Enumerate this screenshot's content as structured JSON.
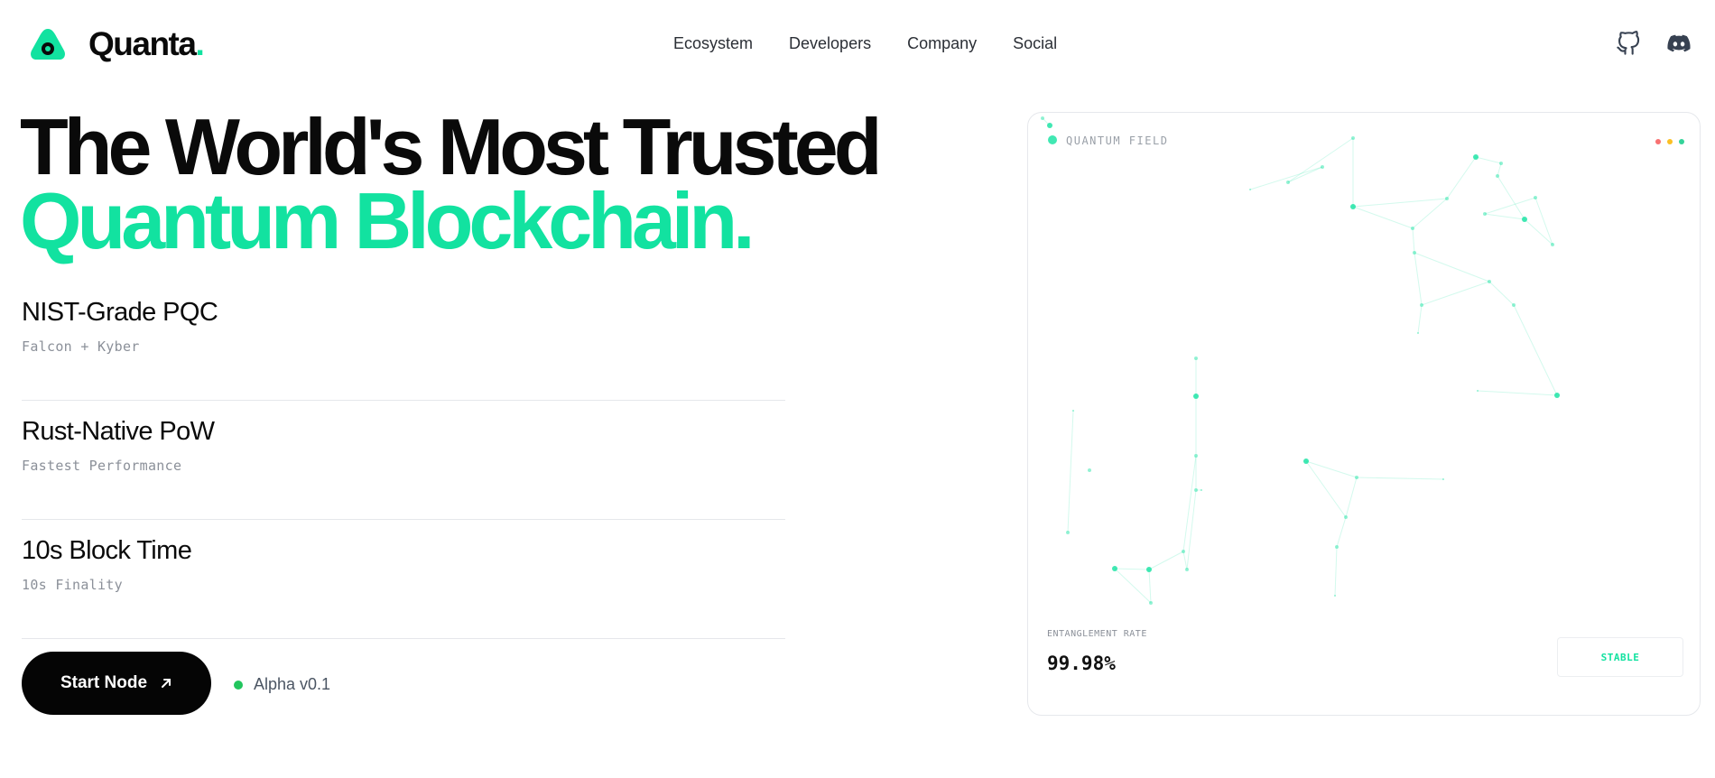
{
  "brand": {
    "name": "Quanta",
    "dot": ".",
    "accent": "#12e2a0"
  },
  "nav": {
    "links": [
      "Ecosystem",
      "Developers",
      "Company",
      "Social"
    ],
    "icons": [
      "github-icon",
      "discord-icon"
    ]
  },
  "hero": {
    "line1": "The World's Most Trusted",
    "line2": "Quantum Blockchain."
  },
  "features": [
    {
      "title": "NIST-Grade PQC",
      "subtitle": "Falcon + Kyber"
    },
    {
      "title": "Rust-Native PoW",
      "subtitle": "Fastest Performance"
    },
    {
      "title": "10s Block Time",
      "subtitle": "10s Finality"
    }
  ],
  "cta": {
    "label": "Start Node",
    "icon": "arrow-up-right-icon"
  },
  "status": {
    "label": "Alpha v0.1",
    "color": "#22c55e"
  },
  "card": {
    "label": "QUANTUM FIELD",
    "window_dots": [
      "#f87171",
      "#fbbf24",
      "#34d399"
    ],
    "metric_label": "ENTANGLEMENT RATE",
    "metric_value": "99.98%",
    "state": "STABLE"
  }
}
